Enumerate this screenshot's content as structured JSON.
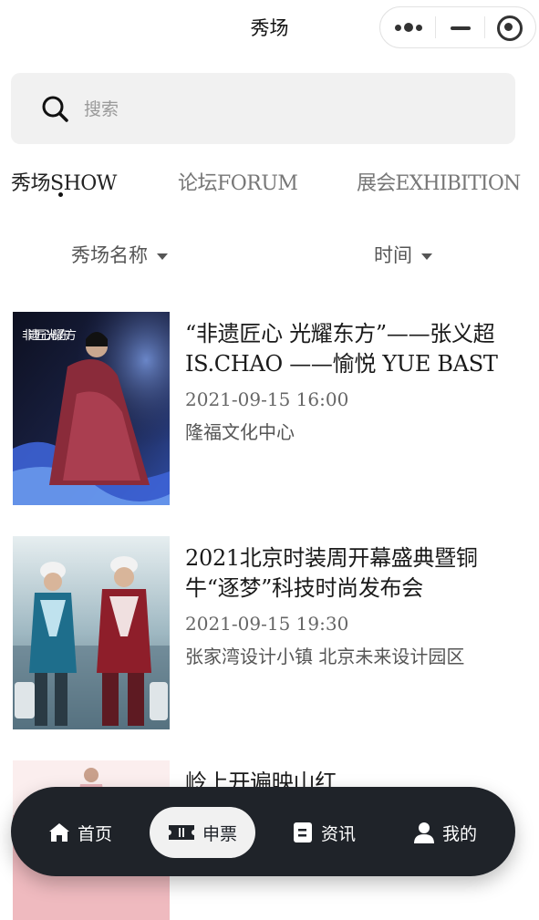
{
  "header": {
    "title": "秀场"
  },
  "search": {
    "placeholder": "搜索",
    "value": ""
  },
  "tabs": [
    {
      "label": "秀场SHOW",
      "active": true
    },
    {
      "label": "论坛FORUM",
      "active": false
    },
    {
      "label": "展会EXHIBITION",
      "active": false
    }
  ],
  "filters": {
    "name_label": "秀场名称",
    "time_label": "时间"
  },
  "events": [
    {
      "title": "“非遗匠心 光耀东方”——张义超IS.CHAO ——愉悦 YUE BAST",
      "time": "2021-09-15 16:00",
      "venue": "隆福文化中心",
      "poster_text": "非遗匠心 光耀东方"
    },
    {
      "title": "2021北京时装周开幕盛典暨铜牛“逐梦”科技时尚发布会",
      "time": "2021-09-15 19:30",
      "venue": "张家湾设计小镇 北京未来设计园区"
    },
    {
      "title": "岭上开遍映山红"
    }
  ],
  "nav": {
    "home": "首页",
    "ticket": "申票",
    "news": "资讯",
    "mine": "我的"
  },
  "icons": [
    "more-dots-icon",
    "minimize-icon",
    "target-icon",
    "search-icon",
    "caret-down-icon",
    "home-icon",
    "ticket-icon",
    "news-icon",
    "user-icon"
  ],
  "colors": {
    "nav_bg": "#1f2329",
    "nav_active_bg": "#f1f1f1",
    "search_bg": "#f1f1f1"
  }
}
